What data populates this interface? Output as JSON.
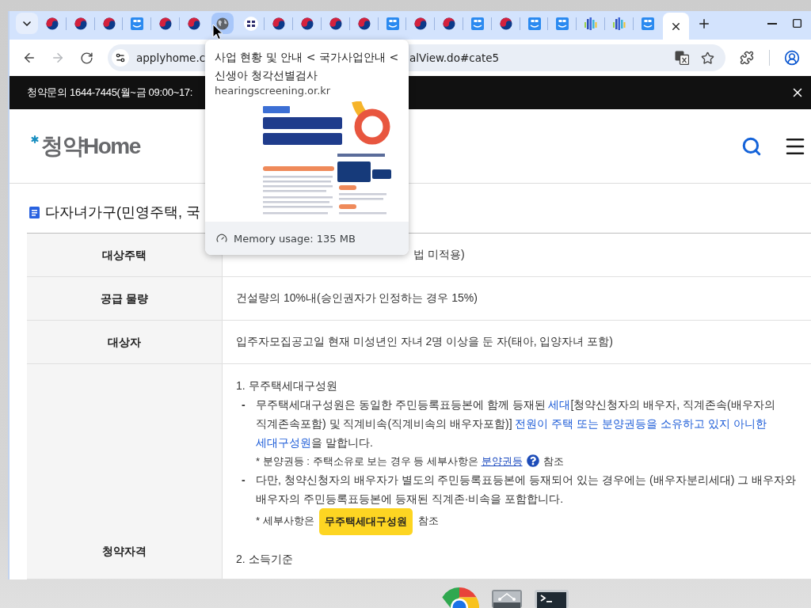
{
  "browser": {
    "tabs": [
      {
        "kind": "taeguk",
        "selected": false,
        "hovered": false
      },
      {
        "kind": "taeguk",
        "selected": false,
        "hovered": false
      },
      {
        "kind": "taeguk",
        "selected": false,
        "hovered": false
      },
      {
        "kind": "app",
        "selected": false,
        "hovered": false
      },
      {
        "kind": "taeguk",
        "selected": false,
        "hovered": false
      },
      {
        "kind": "taeguk",
        "selected": false,
        "hovered": false
      },
      {
        "kind": "globe",
        "selected": false,
        "hovered": true
      },
      {
        "kind": "badge",
        "selected": false,
        "hovered": false
      },
      {
        "kind": "taeguk",
        "selected": false,
        "hovered": false
      },
      {
        "kind": "taeguk",
        "selected": false,
        "hovered": false
      },
      {
        "kind": "taeguk",
        "selected": false,
        "hovered": false
      },
      {
        "kind": "taeguk",
        "selected": false,
        "hovered": false
      },
      {
        "kind": "app",
        "selected": false,
        "hovered": false
      },
      {
        "kind": "taeguk",
        "selected": false,
        "hovered": false
      },
      {
        "kind": "taeguk",
        "selected": false,
        "hovered": false
      },
      {
        "kind": "app",
        "selected": false,
        "hovered": false
      },
      {
        "kind": "taeguk",
        "selected": false,
        "hovered": false
      },
      {
        "kind": "app",
        "selected": false,
        "hovered": false
      },
      {
        "kind": "app",
        "selected": false,
        "hovered": false
      },
      {
        "kind": "bars",
        "selected": false,
        "hovered": false
      },
      {
        "kind": "bars",
        "selected": false,
        "hovered": false
      },
      {
        "kind": "app",
        "selected": false,
        "hovered": false
      },
      {
        "selected": true,
        "hovered": false
      }
    ],
    "nav_buttons": [
      {
        "kind": "back",
        "disabled": false
      },
      {
        "kind": "forward",
        "disabled": true
      },
      {
        "kind": "reload",
        "disabled": false
      }
    ],
    "url": {
      "start": "applyhome.c",
      "end": "alView.do#cate5"
    }
  },
  "hover_card": {
    "title": "사업 현황 및 안내 < 국가사업안내 < 신생아 청각선별검사",
    "domain": "hearingscreening.or.kr",
    "memory": "Memory usage: 135 MB"
  },
  "page": {
    "notice": "청약문의 1644-7445(월~금 09:00~17:",
    "logo": "청약Home",
    "section_title": "다자녀가구(민영주택, 국",
    "table": {
      "rows": [
        {
          "kind": "covered",
          "header": "대상주택",
          "text": "법 미적용)"
        },
        {
          "kind": "plain",
          "header": "공급 물량",
          "text": "건설량의 10%내(승인권자가 인정하는 경우 15%)"
        },
        {
          "kind": "plain",
          "header": "대상자",
          "text": "입주자모집공고일 현재 미성년인 자녀 2명 이상을 둔 자(태아, 입양자녀 포함)"
        },
        {
          "kind": "rich",
          "header": "청약자격",
          "blocks": [
            {
              "kind": "heading",
              "text": "1. 무주택세대구성원"
            },
            {
              "kind": "bullet",
              "marker": "-",
              "segments": [
                {
                  "kind": "text",
                  "text": "무주택세대구성원은 동일한 주민등록표등본에 함께 등재된 "
                },
                {
                  "kind": "link",
                  "text": "세대"
                },
                {
                  "kind": "text",
                  "text": "[청약신청자의 배우자, 직계존속(배우자의 직계존속포함) 및 직계비속(직계비속의 배우자포함)] "
                },
                {
                  "kind": "emphasis",
                  "text": "전원이 주택 또는 분양권등을 소유하고 있지 아니한 세대구성원"
                },
                {
                  "kind": "text",
                  "text": "을 말합니다."
                }
              ]
            },
            {
              "kind": "note",
              "segments": [
                {
                  "kind": "text",
                  "text": "* 분양권등 : 주택소유로 보는 경우 등 세부사항은 "
                },
                {
                  "kind": "underline_link",
                  "text": "분양권등"
                },
                {
                  "kind": "help"
                },
                {
                  "kind": "text",
                  "text": " 참조"
                }
              ]
            },
            {
              "kind": "bullet",
              "marker": "-",
              "segments": [
                {
                  "kind": "text",
                  "text": "다만, 청약신청자의 배우자가 별도의 주민등록표등본에 등재되어 있는 경우에는 (배우자분리세대) 그 배우자와 배우자의 주민등록표등본에 등재된 직계존·비속을 포함합니다."
                }
              ]
            },
            {
              "kind": "note",
              "segments": [
                {
                  "kind": "text",
                  "text": "* 세부사항은 "
                },
                {
                  "kind": "button",
                  "text": "무주택세대구성원"
                },
                {
                  "kind": "text",
                  "text": " 참조"
                }
              ]
            },
            {
              "kind": "heading",
              "text": "2. 소득기준"
            }
          ]
        }
      ]
    }
  },
  "shelf": {
    "apps": [
      {
        "kind": "browser"
      },
      {
        "kind": "files"
      },
      {
        "kind": "terminal"
      }
    ]
  }
}
